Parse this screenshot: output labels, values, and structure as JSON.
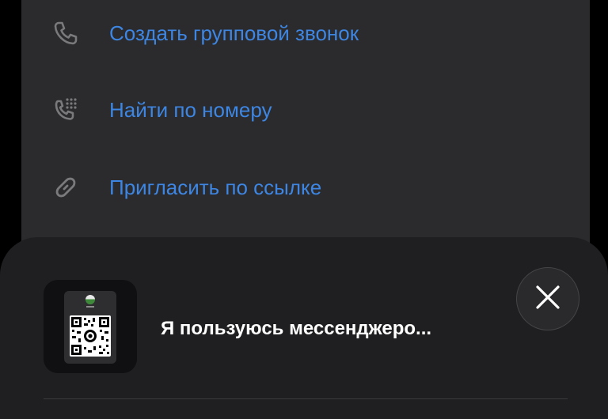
{
  "menu": {
    "items": [
      {
        "label": "Создать групповой звонок",
        "icon": "phone-icon"
      },
      {
        "label": "Найти по номеру",
        "icon": "phone-keypad-icon"
      },
      {
        "label": "Пригласить по ссылке",
        "icon": "link-icon"
      }
    ]
  },
  "share_sheet": {
    "title": "Я пользуюсь мессенджеро...",
    "thumbnail_icon": "qr-code-preview",
    "close_icon": "close-icon"
  },
  "colors": {
    "accent": "#3d86e3",
    "panel": "#2b2b2d",
    "sheet": "#1f1f21",
    "icon": "#7a7a7c"
  }
}
